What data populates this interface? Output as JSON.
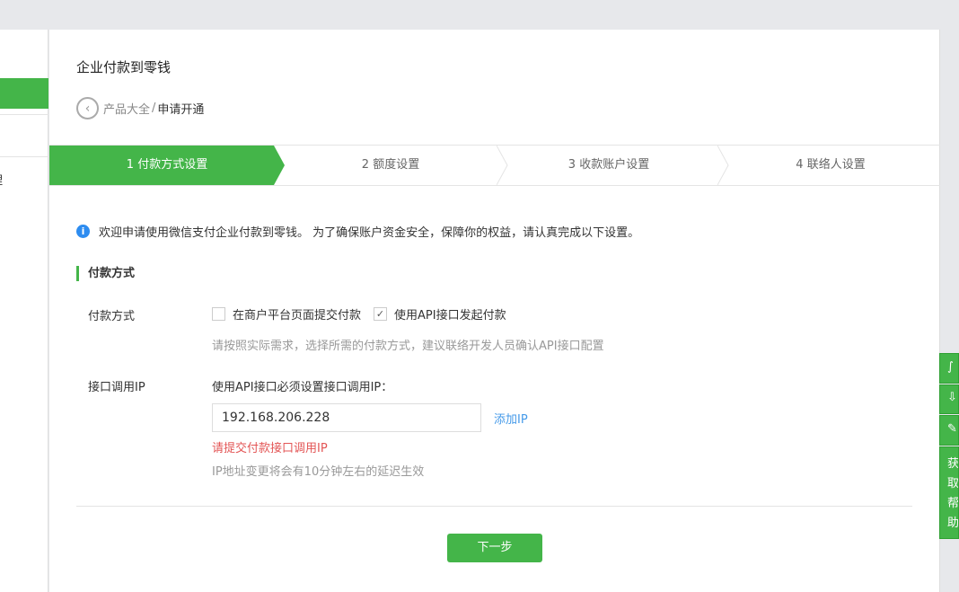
{
  "sidebar": {
    "partial_text": "理"
  },
  "header": {
    "title": "企业付款到零钱",
    "breadcrumb": {
      "parent": "产品大全",
      "separator": "/",
      "current": "申请开通"
    }
  },
  "steps": [
    {
      "label": "1 付款方式设置",
      "active": true
    },
    {
      "label": "2 额度设置"
    },
    {
      "label": "3 收款账户设置"
    },
    {
      "label": "4 联络人设置"
    }
  ],
  "notice": "欢迎申请使用微信支付企业付款到零钱。 为了确保账户资金安全，保障你的权益，请认真完成以下设置。",
  "section_title": "付款方式",
  "form": {
    "payment_method": {
      "label": "付款方式",
      "options": [
        {
          "label": "在商户平台页面提交付款",
          "checked": false
        },
        {
          "label": "使用API接口发起付款",
          "checked": true
        }
      ],
      "hint": "请按照实际需求，选择所需的付款方式，建议联络开发人员确认API接口配置"
    },
    "ip": {
      "label": "接口调用IP",
      "desc": "使用API接口必须设置接口调用IP：",
      "value": "192.168.206.228",
      "add_label": "添加IP",
      "error": "请提交付款接口调用IP",
      "hint": "IP地址变更将会有10分钟左右的延迟生效"
    }
  },
  "next_button": "下一步",
  "float_tools": {
    "help_label": "获取帮助"
  },
  "colors": {
    "accent": "#44b549",
    "link": "#459ae9",
    "error": "#e35555"
  }
}
